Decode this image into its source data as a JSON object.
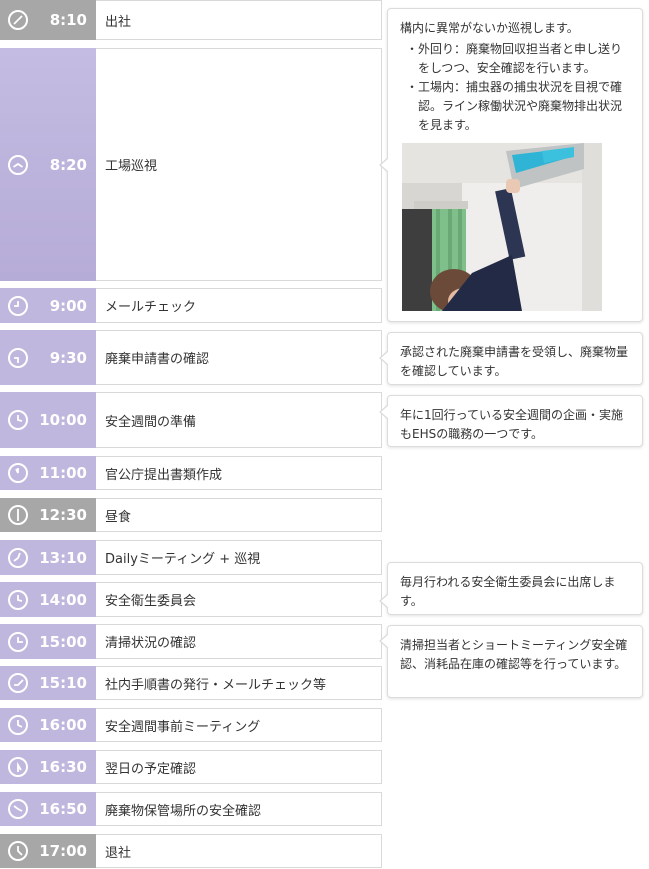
{
  "schedule": [
    {
      "time": "8:10",
      "label": "出社",
      "tone": "gray"
    },
    {
      "time": "8:20",
      "label": "工場巡視",
      "tone": "tall"
    },
    {
      "time": "9:00",
      "label": "メールチェック",
      "tone": "purple"
    },
    {
      "time": "9:30",
      "label": "廃棄申請書の確認",
      "tone": "purple"
    },
    {
      "time": "10:00",
      "label": "安全週間の準備",
      "tone": "purple"
    },
    {
      "time": "11:00",
      "label": "官公庁提出書類作成",
      "tone": "purple"
    },
    {
      "time": "12:30",
      "label": "昼食",
      "tone": "gray"
    },
    {
      "time": "13:10",
      "label": "Dailyミーティング + 巡視",
      "tone": "purple"
    },
    {
      "time": "14:00",
      "label": "安全衛生委員会",
      "tone": "purple"
    },
    {
      "time": "15:00",
      "label": "清掃状況の確認",
      "tone": "purple"
    },
    {
      "time": "15:10",
      "label": "社内手順書の発行・メールチェック等",
      "tone": "purple"
    },
    {
      "time": "16:00",
      "label": "安全週間事前ミーティング",
      "tone": "purple"
    },
    {
      "time": "16:30",
      "label": "翌日の予定確認",
      "tone": "purple"
    },
    {
      "time": "16:50",
      "label": "廃棄物保管場所の安全確認",
      "tone": "purple"
    },
    {
      "time": "17:00",
      "label": "退社",
      "tone": "gray"
    }
  ],
  "notes": {
    "patrol": {
      "intro": "構内に異常がないか巡視します。",
      "items": [
        "外回り：廃棄物回収担当者と申し送りをしつつ、安全確認を行います。",
        "工場内：捕虫器の捕虫状況を目視で確認。ライン稼働状況や廃棄物排出状況を見ます。"
      ]
    },
    "disposal": "承認された廃棄申請書を受領し、廃棄物量を確認しています。",
    "safety_week": "年に1回行っている安全週間の企画・実施もEHSの職務の一つです。",
    "committee": "毎月行われる安全衛生委員会に出席します。",
    "cleaning": "清掃担当者とショートミーティング安全確認、消耗品在庫の確認等を行っています。"
  },
  "colors": {
    "gray": "#a7a7a7",
    "purple": "#bfb7dd",
    "accent_text": "#ffffff"
  }
}
